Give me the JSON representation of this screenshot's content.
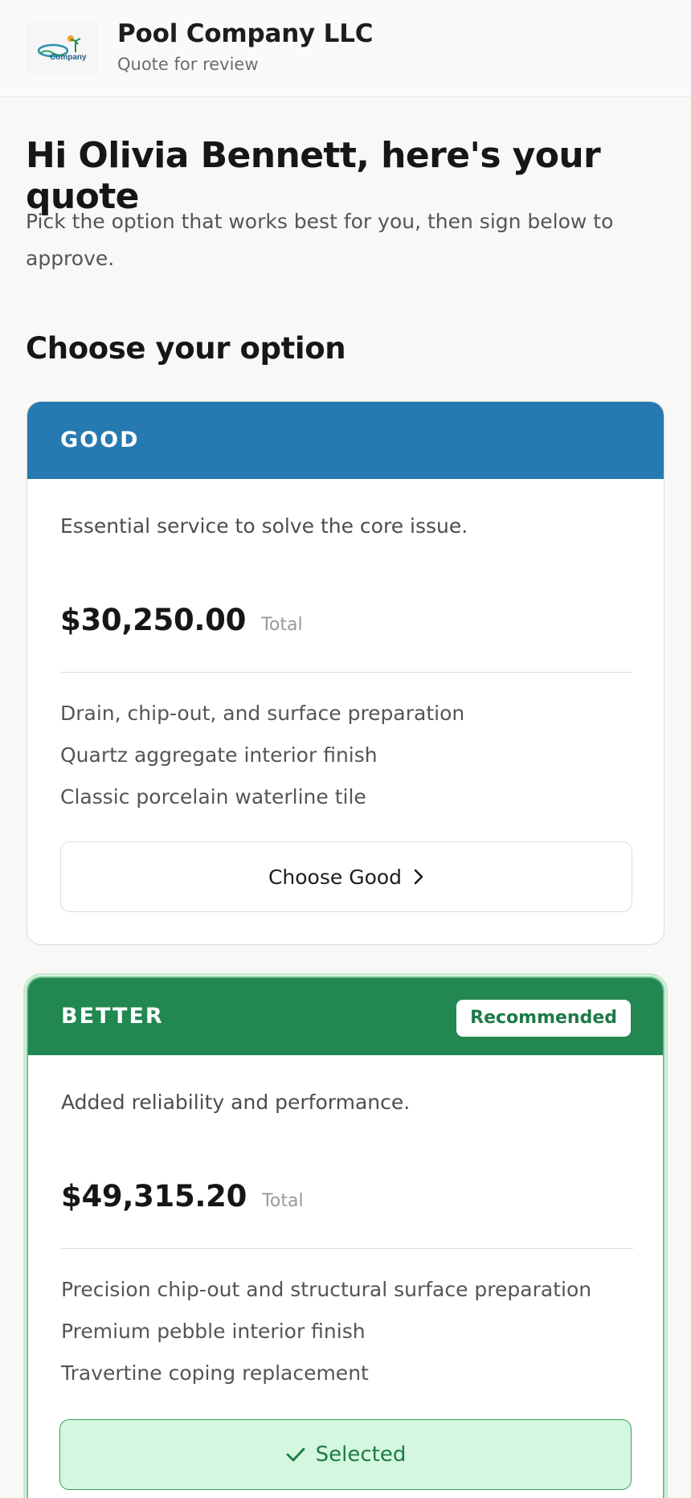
{
  "header": {
    "logo_text": "Company",
    "company_name": "Pool Company LLC",
    "subtitle": "Quote for review"
  },
  "intro": {
    "greeting": "Hi Olivia Bennett, here's your quote",
    "instructions": "Pick the option that works best for you, then sign below to approve."
  },
  "section_title": "Choose your option",
  "options": [
    {
      "tier": "GOOD",
      "header_color": "#2679b1",
      "description": "Essential service to solve the core issue.",
      "price": "$30,250.00",
      "price_suffix": "Total",
      "features": [
        "Drain, chip-out, and surface preparation",
        "Quartz aggregate interior finish",
        "Classic porcelain waterline tile"
      ],
      "button_label": "Choose Good"
    },
    {
      "tier": "BETTER",
      "header_color": "#228751",
      "badge": "Recommended",
      "description": "Added reliability and performance.",
      "price": "$49,315.20",
      "price_suffix": "Total",
      "features": [
        "Precision chip-out and structural surface preparation",
        "Premium pebble interior finish",
        "Travertine coping replacement"
      ],
      "button_label": "Selected"
    }
  ]
}
